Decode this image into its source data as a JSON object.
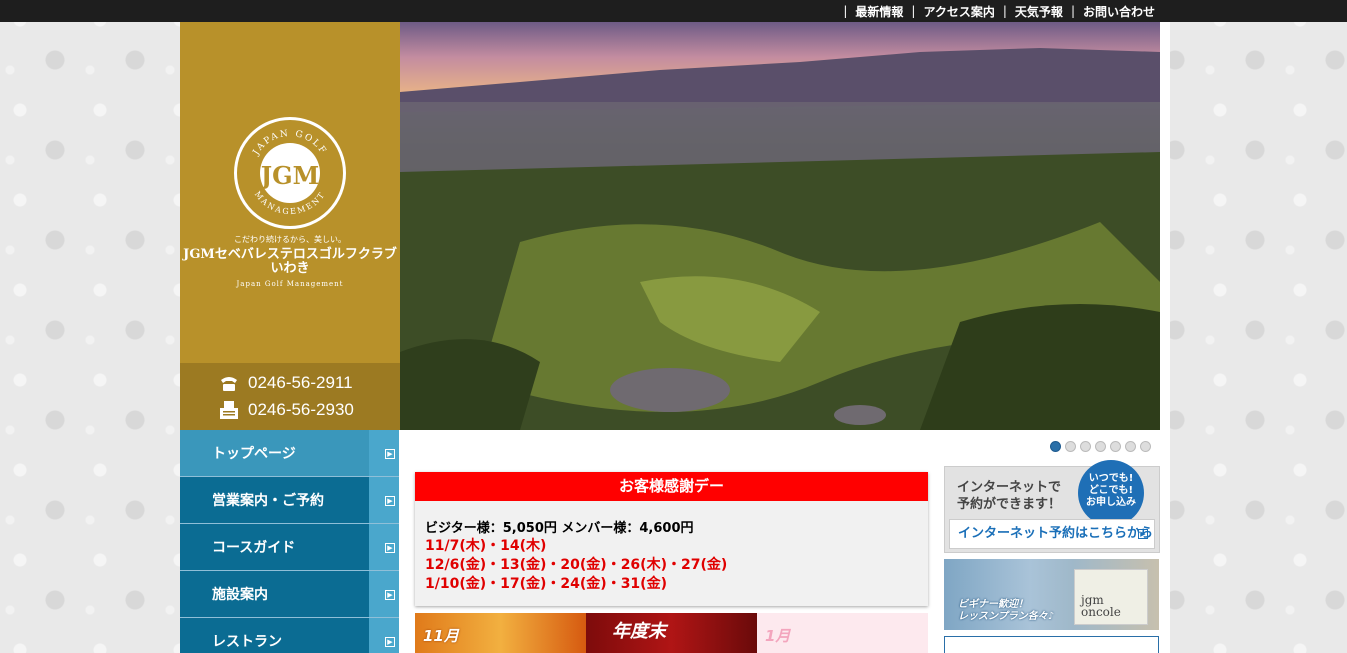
{
  "topnav": {
    "items": [
      "最新情報",
      "アクセス案内",
      "天気予報",
      "お問い合わせ"
    ],
    "separator": "|"
  },
  "logo": {
    "emblem_top": "JAPAN GOLF",
    "emblem_bottom": "MANAGEMENT",
    "emblem_letters": "JGM",
    "tagline": "こだわり続けるから、美しい。",
    "club_name_line1": "JGMセベバレステロスゴルフクラブ",
    "club_name_line2": "いわき",
    "sub": "Japan Golf Management"
  },
  "contact": {
    "phone": "0246-56-2911",
    "fax": "0246-56-2930",
    "phone_icon": "phone-icon",
    "fax_icon": "fax-icon"
  },
  "slider": {
    "dot_count": 7,
    "active_index": 0
  },
  "sidenav": {
    "items": [
      {
        "label": "トップページ"
      },
      {
        "label": "営業案内・ご予約"
      },
      {
        "label": "コースガイド"
      },
      {
        "label": "施設案内"
      },
      {
        "label": "レストラン"
      }
    ]
  },
  "thanks": {
    "title": "お客様感謝デー",
    "prices": "ビジター様：5,050円  メンバー様：4,600円",
    "dates": [
      "11/7(木)・14(木)",
      "12/6(金)・13(金)・20(金)・26(木)・27(金)",
      "1/10(金)・17(金)・24(金)・31(金)"
    ]
  },
  "banners": {
    "b1": "11月",
    "b2": "年度末",
    "b3": "1月"
  },
  "internet": {
    "text_line1": "インターネットで",
    "text_line2": "予約ができます！",
    "bubble_line1": "いつでも!",
    "bubble_line2": "どこでも!",
    "bubble_line3": "お申し込み",
    "link": "インターネット予約はこちらから"
  },
  "lesson": {
    "line1": "ビギナー歓迎！",
    "line2": "レッスンプラン各々♪",
    "logo_line1": "jgm",
    "logo_line2": "oncole"
  },
  "colors": {
    "gold": "#b8912a",
    "nav_blue": "#0b6c93",
    "accent_red": "#ff0000"
  }
}
